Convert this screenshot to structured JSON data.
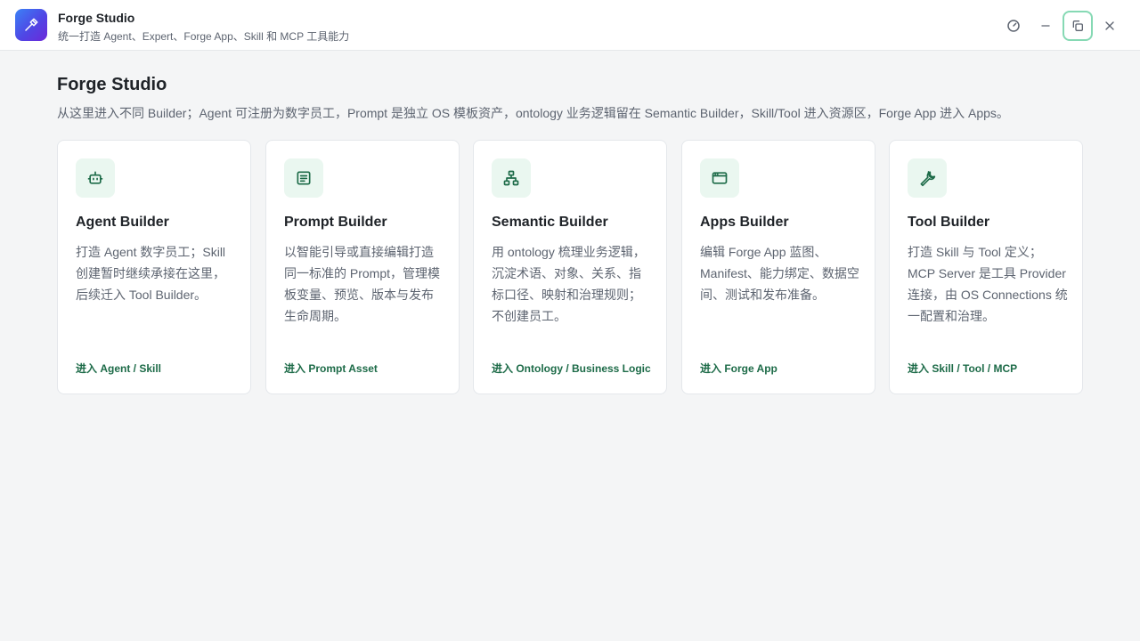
{
  "app": {
    "title": "Forge Studio",
    "subtitle": "统一打造 Agent、Expert、Forge App、Skill 和 MCP 工具能力"
  },
  "window_controls": [
    "gauge-icon",
    "minimize-icon",
    "restore-icon",
    "close-icon"
  ],
  "page": {
    "title": "Forge Studio",
    "description": "从这里进入不同 Builder；Agent 可注册为数字员工，Prompt 是独立 OS 模板资产，ontology 业务逻辑留在 Semantic Builder，Skill/Tool 进入资源区，Forge App 进入 Apps。"
  },
  "cards": [
    {
      "icon": "robot-icon",
      "title": "Agent Builder",
      "description": "打造 Agent 数字员工；Skill 创建暂时继续承接在这里，后续迁入 Tool Builder。",
      "link": "进入 Agent / Skill"
    },
    {
      "icon": "document-icon",
      "title": "Prompt Builder",
      "description": "以智能引导或直接编辑打造同一标准的 Prompt，管理模板变量、预览、版本与发布生命周期。",
      "link": "进入 Prompt Asset"
    },
    {
      "icon": "hierarchy-icon",
      "title": "Semantic Builder",
      "description": "用 ontology 梳理业务逻辑，沉淀术语、对象、关系、指标口径、映射和治理规则；不创建员工。",
      "link": "进入 Ontology / Business Logic"
    },
    {
      "icon": "app-window-icon",
      "title": "Apps Builder",
      "description": "编辑 Forge App 蓝图、Manifest、能力绑定、数据空间、测试和发布准备。",
      "link": "进入 Forge App"
    },
    {
      "icon": "wrench-icon",
      "title": "Tool Builder",
      "description": "打造 Skill 与 Tool 定义；MCP Server 是工具 Provider 连接，由 OS Connections 统一配置和治理。",
      "link": "进入 Skill / Tool / MCP"
    }
  ],
  "colors": {
    "accent": "#1d6b48",
    "icon_bg": "#eaf7f0",
    "logo_gradient_start": "#3b82f6",
    "logo_gradient_end": "#6d28d9"
  }
}
